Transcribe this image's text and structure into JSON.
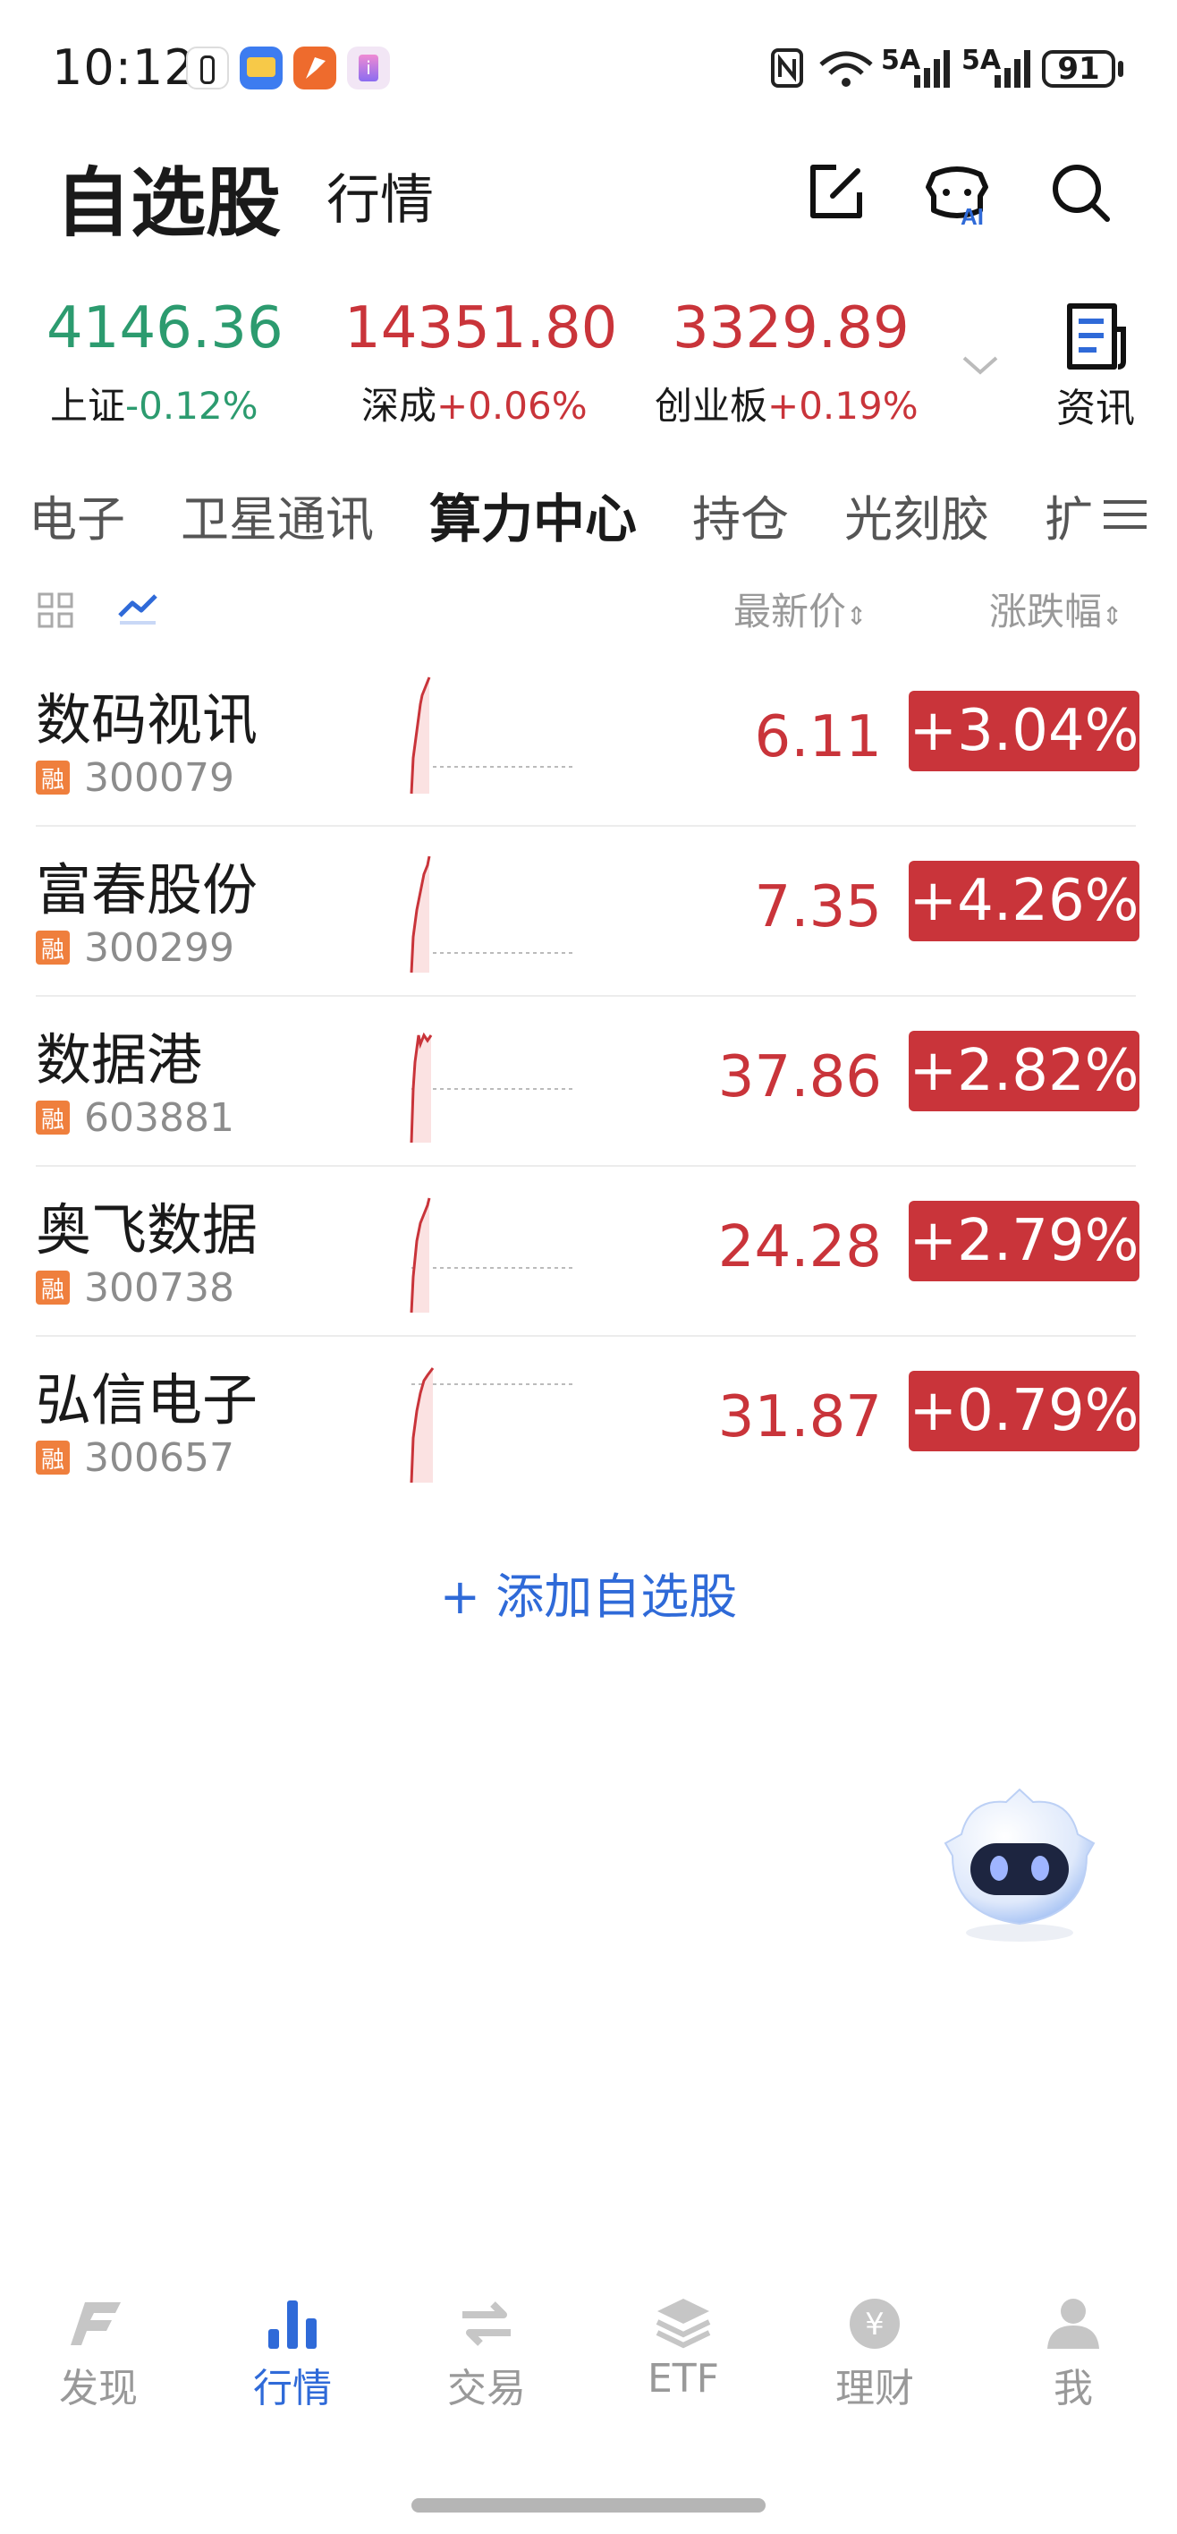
{
  "status": {
    "time": "10:12",
    "battery": "91"
  },
  "header": {
    "title": "自选股",
    "title2": "行情"
  },
  "indices": [
    {
      "value": "4146.36",
      "label": "上证",
      "change": "-0.12%",
      "dir": "down"
    },
    {
      "value": "14351.80",
      "label": "深成",
      "change": "+0.06%",
      "dir": "up"
    },
    {
      "value": "3329.89",
      "label": "创业板",
      "change": "+0.19%",
      "dir": "up"
    }
  ],
  "news_label": "资讯",
  "tabs": [
    "电子",
    "卫星通讯",
    "算力中心",
    "持仓",
    "光刻胶",
    "扩"
  ],
  "active_tab": "算力中心",
  "list_header": {
    "price": "最新价",
    "change": "涨跌幅"
  },
  "stocks": [
    {
      "name": "数码视讯",
      "tag": "融",
      "code": "300079",
      "price": "6.11",
      "change": "+3.04%"
    },
    {
      "name": "富春股份",
      "tag": "融",
      "code": "300299",
      "price": "7.35",
      "change": "+4.26%"
    },
    {
      "name": "数据港",
      "tag": "融",
      "code": "603881",
      "price": "37.86",
      "change": "+2.82%"
    },
    {
      "name": "奥飞数据",
      "tag": "融",
      "code": "300738",
      "price": "24.28",
      "change": "+2.79%"
    },
    {
      "name": "弘信电子",
      "tag": "融",
      "code": "300657",
      "price": "31.87",
      "change": "+0.79%"
    }
  ],
  "add_label": "+ 添加自选股",
  "nav": [
    {
      "label": "发现",
      "icon": "discover-icon"
    },
    {
      "label": "行情",
      "icon": "market-icon",
      "active": true
    },
    {
      "label": "交易",
      "icon": "trade-icon"
    },
    {
      "label": "ETF",
      "icon": "etf-icon"
    },
    {
      "label": "理财",
      "icon": "finance-icon"
    },
    {
      "label": "我",
      "icon": "profile-icon"
    }
  ],
  "colors": {
    "up": "#c9343a",
    "down": "#2c9b6f",
    "accent": "#2f6ad8",
    "tag": "#ef7f3d"
  }
}
